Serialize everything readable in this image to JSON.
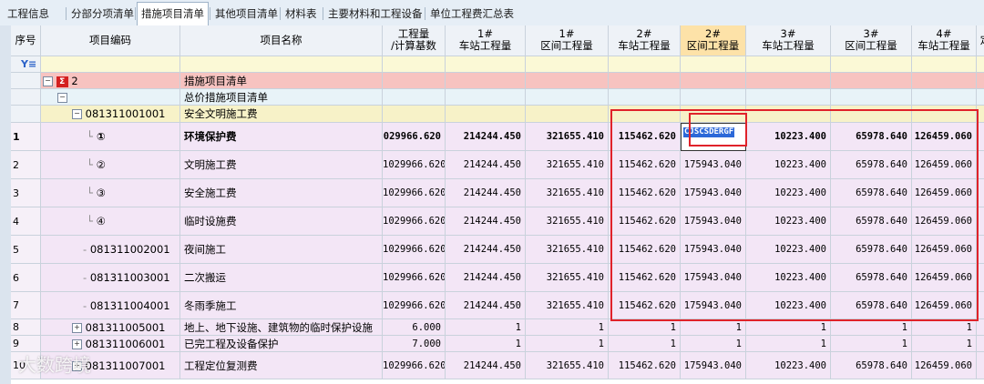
{
  "tabs": [
    "工程信息",
    "分部分项清单",
    "措施项目清单",
    "其他项目清单",
    "材料表",
    "主要材料和工程设备",
    "单位工程费汇总表"
  ],
  "active_tab": 2,
  "columns": [
    "序号",
    "项目编码",
    "项目名称",
    "工程量\n/计算基数",
    "1#\n车站工程量",
    "1#\n区间工程量",
    "2#\n车站工程量",
    "2#\n区间工程量",
    "3#\n车站工程量",
    "3#\n区间工程量",
    "4#\n车站工程量",
    "定"
  ],
  "filter_icon": "funnel-icon",
  "rows": [
    {
      "seq": "",
      "code": "2",
      "name": "措施项目清单",
      "type": "group",
      "values": [
        "",
        "",
        "",
        "",
        "",
        "",
        "",
        ""
      ]
    },
    {
      "seq": "",
      "code": "",
      "name": "总价措施项目清单",
      "type": "sub",
      "values": [
        "",
        "",
        "",
        "",
        "",
        "",
        "",
        ""
      ]
    },
    {
      "seq": "",
      "code": "081311001001",
      "name": "安全文明施工费",
      "type": "item",
      "values": [
        "",
        "",
        "",
        "",
        "",
        "",
        "",
        ""
      ]
    },
    {
      "seq": "1",
      "code": "①",
      "name": "环境保护费",
      "type": "bold",
      "values": [
        "029966.620",
        "214244.450",
        "321655.410",
        "115462.620",
        "CJSCSDERGF",
        "10223.400",
        "65978.640",
        "126459.060"
      ]
    },
    {
      "seq": "2",
      "code": "②",
      "name": "文明施工费",
      "type": "child",
      "values": [
        "1029966.620",
        "214244.450",
        "321655.410",
        "115462.620",
        "175943.040",
        "10223.400",
        "65978.640",
        "126459.060"
      ]
    },
    {
      "seq": "3",
      "code": "③",
      "name": "安全施工费",
      "type": "child",
      "values": [
        "1029966.620",
        "214244.450",
        "321655.410",
        "115462.620",
        "175943.040",
        "10223.400",
        "65978.640",
        "126459.060"
      ]
    },
    {
      "seq": "4",
      "code": "④",
      "name": "临时设施费",
      "type": "child",
      "values": [
        "1029966.620",
        "214244.450",
        "321655.410",
        "115462.620",
        "175943.040",
        "10223.400",
        "65978.640",
        "126459.060"
      ]
    },
    {
      "seq": "5",
      "code": "081311002001",
      "name": "夜间施工",
      "type": "child",
      "values": [
        "1029966.620",
        "214244.450",
        "321655.410",
        "115462.620",
        "175943.040",
        "10223.400",
        "65978.640",
        "126459.060"
      ]
    },
    {
      "seq": "6",
      "code": "081311003001",
      "name": "二次搬运",
      "type": "child",
      "values": [
        "1029966.620",
        "214244.450",
        "321655.410",
        "115462.620",
        "175943.040",
        "10223.400",
        "65978.640",
        "126459.060"
      ]
    },
    {
      "seq": "7",
      "code": "081311004001",
      "name": "冬雨季施工",
      "type": "child",
      "values": [
        "1029966.620",
        "214244.450",
        "321655.410",
        "115462.620",
        "175943.040",
        "10223.400",
        "65978.640",
        "126459.060"
      ]
    },
    {
      "seq": "8",
      "code": "081311005001",
      "name": "地上、地下设施、建筑物的临时保护设施",
      "type": "plus",
      "values": [
        "6.000",
        "1",
        "1",
        "1",
        "1",
        "1",
        "1",
        "1"
      ]
    },
    {
      "seq": "9",
      "code": "081311006001",
      "name": "已完工程及设备保护",
      "type": "plus",
      "values": [
        "7.000",
        "1",
        "1",
        "1",
        "1",
        "1",
        "1",
        "1"
      ]
    },
    {
      "seq": "10",
      "code": "081311007001",
      "name": "工程定位复测费",
      "type": "plus",
      "values": [
        "1029966.620",
        "214244.450",
        "321655.410",
        "115462.620",
        "175943.040",
        "10223.400",
        "65978.640",
        "126459.060"
      ]
    }
  ],
  "editing_cell_text": "CJSCSDERGF",
  "watermark": "大数跨境",
  "colors": {
    "group": "#f7c3c0",
    "sub": "#e8f3f8",
    "item": "#f7f2c8",
    "child": "#f3e6f6",
    "header": "#eef2f7",
    "highlight_header": "#fde2a8",
    "redbox": "#e0222a"
  }
}
